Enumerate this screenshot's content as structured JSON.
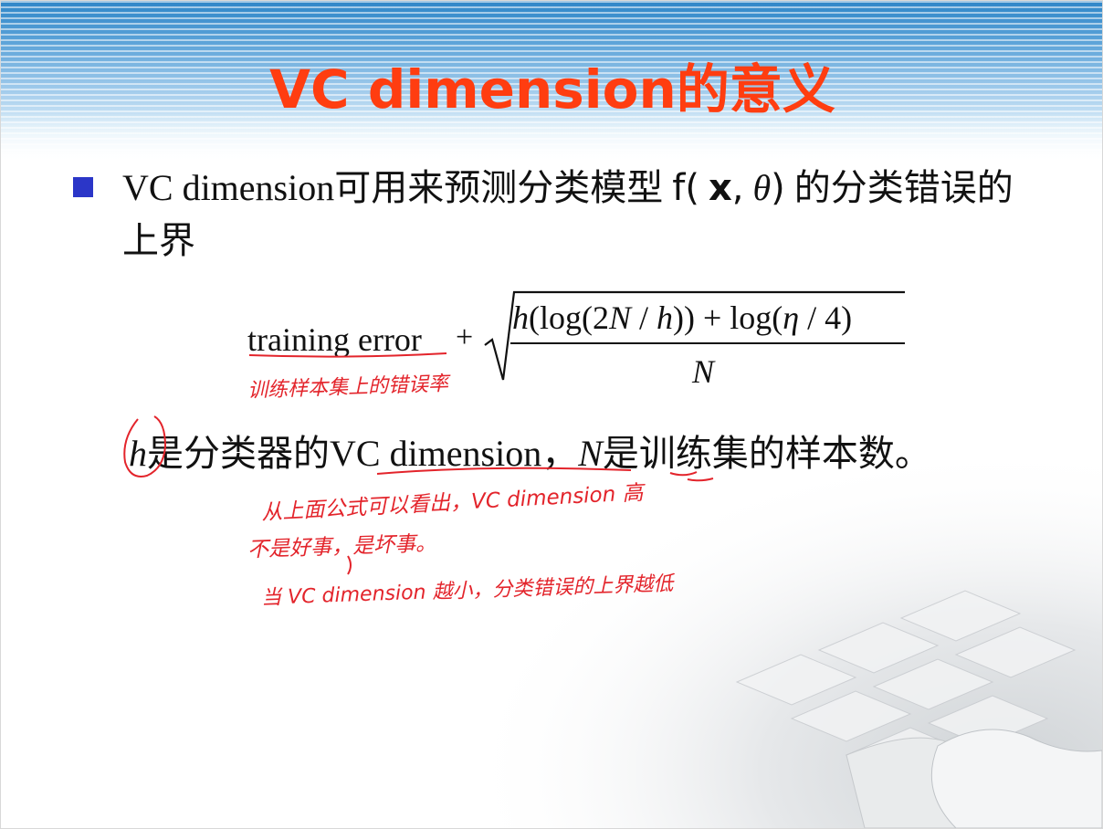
{
  "slide": {
    "title": "VC dimension的意义",
    "bullet": {
      "text_before": "VC dimension可用来预测分类模型 ",
      "fn": "f",
      "open_paren": "(",
      "x": "x",
      "comma": ",",
      "theta": "θ",
      "close_paren": ")",
      "text_after": " 的分类错误的上界"
    },
    "formula": {
      "lhs": "training error",
      "plus": "+",
      "num_h": "h",
      "num_rest_1": "(log(2",
      "num_N": "N",
      "num_rest_2": " / ",
      "num_h2": "h",
      "num_rest_3": ")) + log(",
      "num_eta": "η",
      "num_rest_4": " / 4)",
      "den": "N"
    },
    "line2": {
      "h": "h",
      "text1": "是分类器的VC dimension，",
      "N": "N",
      "text2": "是训练集的样本数。"
    },
    "annotations": {
      "a1": "训练样本集上的错误率",
      "a2": "从上面公式可以看出，VC dimension 高",
      "a3": "不是好事，是坏事。",
      "a4": "当 VC dimension 越小，分类错误的上界越低"
    },
    "colors": {
      "title": "#ff3d10",
      "bullet_marker": "#2b36c8",
      "ink": "#e3242b"
    }
  }
}
